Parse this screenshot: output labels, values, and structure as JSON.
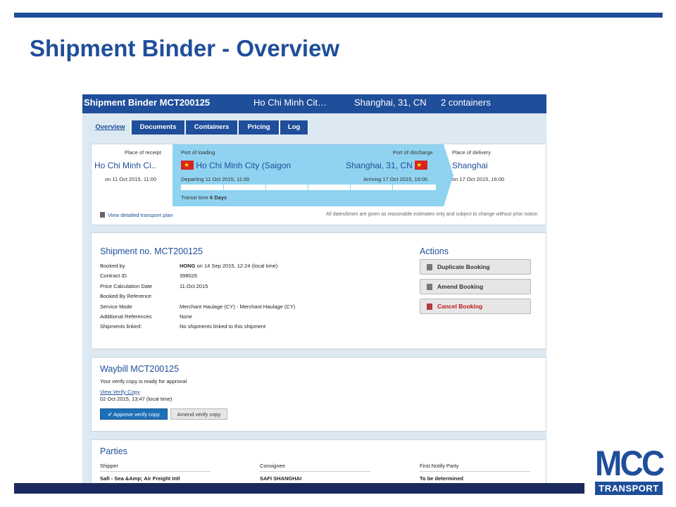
{
  "slide": {
    "title": "Shipment Binder - Overview",
    "brand_color": "#1f4e9a",
    "logo": {
      "name": "MCC",
      "sub": "TRANSPORT"
    }
  },
  "app": {
    "header": {
      "title": "Shipment Binder MCT200125",
      "from": "Ho Chi Minh Cit…",
      "to": "Shanghai, 31, CN",
      "containers": "2 containers"
    },
    "tabs": [
      {
        "label": "Overview",
        "active": true
      },
      {
        "label": "Documents"
      },
      {
        "label": "Containers"
      },
      {
        "label": "Pricing"
      },
      {
        "label": "Log"
      }
    ],
    "route": {
      "receipt": {
        "label": "Place of receipt",
        "city": "Ho Chi Minh Ci..",
        "date": "on 11 Oct 2015, 11:00"
      },
      "loading": {
        "label": "Port of loading",
        "city": "Ho Chi Minh City (Saigon",
        "date": "Departing 11 Oct 2015, 11:00",
        "flag": "vietnam-flag"
      },
      "discharge": {
        "label": "Port of discharge",
        "city": "Shanghai, 31, CN",
        "date": "Arriving 17 Oct 2015, 16:00",
        "flag": "china-flag"
      },
      "delivery": {
        "label": "Place of delivery",
        "city": "Shanghai",
        "date": "on 17 Oct 2015, 16:00"
      },
      "transit_label": "Transit time",
      "transit_value": "6 Days",
      "transport_plan_link": "View detailed transport plan",
      "note": "All dates/times are given as reasonable estimates only and subject to change without prior notice."
    },
    "shipment": {
      "title": "Shipment no. MCT200125",
      "rows": [
        {
          "key": "Booked by",
          "value_bold": "HONG",
          "value": " on 14 Sep 2015, 12:24 (local time)"
        },
        {
          "key": "Contract ID",
          "value_bold": "",
          "value": "398026"
        },
        {
          "key": "Price Calculation Date",
          "value_bold": "",
          "value": "11.Oct.2015"
        },
        {
          "key": "Booked By Reference",
          "value_bold": "",
          "value": ""
        },
        {
          "key": "Service Mode",
          "value_bold": "",
          "value": "Merchant Haulage (CY) - Merchant Haulage (CY)"
        },
        {
          "key": "Additional References",
          "value_bold": "",
          "value": "None"
        },
        {
          "key": "Shipments linked:",
          "value_bold": "",
          "value": "No shipments linked to this shipment"
        }
      ],
      "actions_title": "Actions",
      "actions": [
        {
          "label": "Duplicate Booking"
        },
        {
          "label": "Amend Booking"
        },
        {
          "label": "Cancel Booking"
        }
      ]
    },
    "waybill": {
      "title": "Waybill MCT200125",
      "status": "Your verify copy is ready for approval",
      "link": "View Verify Copy",
      "date": "02 Oct 2015, 13:47 (local time)",
      "approve_label": "✔ Approve verify copy",
      "amend_label": "Amend verify copy"
    },
    "parties": {
      "title": "Parties",
      "columns": [
        {
          "head": "Shipper",
          "value": "Safi - Sea &Amp; Air Freight Intl"
        },
        {
          "head": "Consignee",
          "value": "SAFI SHANGHAI"
        },
        {
          "head": "First Notify Party",
          "value": "To be determined"
        }
      ]
    }
  }
}
